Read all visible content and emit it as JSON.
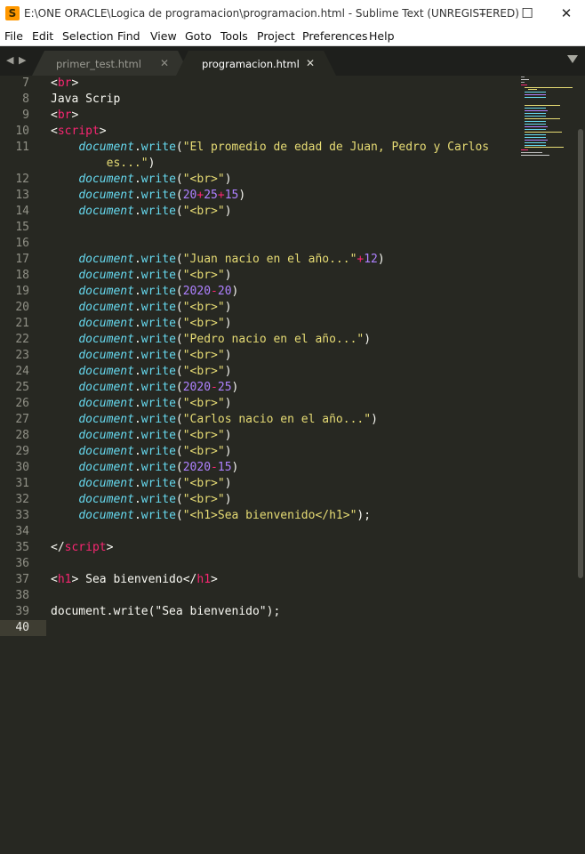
{
  "window": {
    "title": "E:\\ONE ORACLE\\Logica de programacion\\programacion.html - Sublime Text (UNREGISTERED)",
    "app_icon": "S",
    "buttons": {
      "minimize": "–",
      "maximize": "☐",
      "close": "✕"
    }
  },
  "menu": [
    "File",
    "Edit",
    "Selection",
    "Find",
    "View",
    "Goto",
    "Tools",
    "Project",
    "Preferences",
    "Help"
  ],
  "tabs": {
    "nav_left": "◀",
    "nav_right": "▶",
    "items": [
      {
        "label": "primer_test.html",
        "close": "✕",
        "active": false
      },
      {
        "label": "programacion.html",
        "close": "✕",
        "active": true
      }
    ]
  },
  "editor": {
    "active_line": "40",
    "colors": {
      "background": "#272822",
      "tag": "#f92672",
      "object": "#66d9ef",
      "string": "#e6db74",
      "number": "#ae81ff",
      "plain": "#f8f8f2"
    },
    "lines": [
      {
        "n": "7",
        "t": [
          [
            "p",
            "<"
          ],
          [
            "tag",
            "br"
          ],
          [
            "p",
            ">"
          ]
        ]
      },
      {
        "n": "8",
        "t": [
          [
            "p",
            "Java Scrip"
          ]
        ]
      },
      {
        "n": "9",
        "t": [
          [
            "p",
            "<"
          ],
          [
            "tag",
            "br"
          ],
          [
            "p",
            ">"
          ]
        ]
      },
      {
        "n": "10",
        "t": [
          [
            "p",
            "<"
          ],
          [
            "tag",
            "script"
          ],
          [
            "p",
            ">"
          ]
        ]
      },
      {
        "n": "11",
        "t": [
          [
            "p",
            "    "
          ],
          [
            "obj",
            "document"
          ],
          [
            "p",
            "."
          ],
          [
            "fn",
            "write"
          ],
          [
            "p",
            "("
          ],
          [
            "str",
            "\"El promedio de edad de Juan, Pedro y Carlos"
          ]
        ]
      },
      {
        "n": "",
        "t": [
          [
            "str",
            "        es...\""
          ],
          [
            "p",
            ")"
          ]
        ]
      },
      {
        "n": "12",
        "t": [
          [
            "p",
            "    "
          ],
          [
            "obj",
            "document"
          ],
          [
            "p",
            "."
          ],
          [
            "fn",
            "write"
          ],
          [
            "p",
            "("
          ],
          [
            "str",
            "\"<br>\""
          ],
          [
            "p",
            ")"
          ]
        ]
      },
      {
        "n": "13",
        "t": [
          [
            "p",
            "    "
          ],
          [
            "obj",
            "document"
          ],
          [
            "p",
            "."
          ],
          [
            "fn",
            "write"
          ],
          [
            "p",
            "("
          ],
          [
            "num",
            "20"
          ],
          [
            "op",
            "+"
          ],
          [
            "num",
            "25"
          ],
          [
            "op",
            "+"
          ],
          [
            "num",
            "15"
          ],
          [
            "p",
            ")"
          ]
        ]
      },
      {
        "n": "14",
        "t": [
          [
            "p",
            "    "
          ],
          [
            "obj",
            "document"
          ],
          [
            "p",
            "."
          ],
          [
            "fn",
            "write"
          ],
          [
            "p",
            "("
          ],
          [
            "str",
            "\"<br>\""
          ],
          [
            "p",
            ")"
          ]
        ]
      },
      {
        "n": "15",
        "t": []
      },
      {
        "n": "16",
        "t": []
      },
      {
        "n": "17",
        "t": [
          [
            "p",
            "    "
          ],
          [
            "obj",
            "document"
          ],
          [
            "p",
            "."
          ],
          [
            "fn",
            "write"
          ],
          [
            "p",
            "("
          ],
          [
            "str",
            "\"Juan nacio en el año...\""
          ],
          [
            "op",
            "+"
          ],
          [
            "num",
            "12"
          ],
          [
            "p",
            ")"
          ]
        ]
      },
      {
        "n": "18",
        "t": [
          [
            "p",
            "    "
          ],
          [
            "obj",
            "document"
          ],
          [
            "p",
            "."
          ],
          [
            "fn",
            "write"
          ],
          [
            "p",
            "("
          ],
          [
            "str",
            "\"<br>\""
          ],
          [
            "p",
            ")"
          ]
        ]
      },
      {
        "n": "19",
        "t": [
          [
            "p",
            "    "
          ],
          [
            "obj",
            "document"
          ],
          [
            "p",
            "."
          ],
          [
            "fn",
            "write"
          ],
          [
            "p",
            "("
          ],
          [
            "num",
            "2020"
          ],
          [
            "op",
            "-"
          ],
          [
            "num",
            "20"
          ],
          [
            "p",
            ")"
          ]
        ]
      },
      {
        "n": "20",
        "t": [
          [
            "p",
            "    "
          ],
          [
            "obj",
            "document"
          ],
          [
            "p",
            "."
          ],
          [
            "fn",
            "write"
          ],
          [
            "p",
            "("
          ],
          [
            "str",
            "\"<br>\""
          ],
          [
            "p",
            ")"
          ]
        ]
      },
      {
        "n": "21",
        "t": [
          [
            "p",
            "    "
          ],
          [
            "obj",
            "document"
          ],
          [
            "p",
            "."
          ],
          [
            "fn",
            "write"
          ],
          [
            "p",
            "("
          ],
          [
            "str",
            "\"<br>\""
          ],
          [
            "p",
            ")"
          ]
        ]
      },
      {
        "n": "22",
        "t": [
          [
            "p",
            "    "
          ],
          [
            "obj",
            "document"
          ],
          [
            "p",
            "."
          ],
          [
            "fn",
            "write"
          ],
          [
            "p",
            "("
          ],
          [
            "str",
            "\"Pedro nacio en el año...\""
          ],
          [
            "p",
            ")"
          ]
        ]
      },
      {
        "n": "23",
        "t": [
          [
            "p",
            "    "
          ],
          [
            "obj",
            "document"
          ],
          [
            "p",
            "."
          ],
          [
            "fn",
            "write"
          ],
          [
            "p",
            "("
          ],
          [
            "str",
            "\"<br>\""
          ],
          [
            "p",
            ")"
          ]
        ]
      },
      {
        "n": "24",
        "t": [
          [
            "p",
            "    "
          ],
          [
            "obj",
            "document"
          ],
          [
            "p",
            "."
          ],
          [
            "fn",
            "write"
          ],
          [
            "p",
            "("
          ],
          [
            "str",
            "\"<br>\""
          ],
          [
            "p",
            ")"
          ]
        ]
      },
      {
        "n": "25",
        "t": [
          [
            "p",
            "    "
          ],
          [
            "obj",
            "document"
          ],
          [
            "p",
            "."
          ],
          [
            "fn",
            "write"
          ],
          [
            "p",
            "("
          ],
          [
            "num",
            "2020"
          ],
          [
            "op",
            "-"
          ],
          [
            "num",
            "25"
          ],
          [
            "p",
            ")"
          ]
        ]
      },
      {
        "n": "26",
        "t": [
          [
            "p",
            "    "
          ],
          [
            "obj",
            "document"
          ],
          [
            "p",
            "."
          ],
          [
            "fn",
            "write"
          ],
          [
            "p",
            "("
          ],
          [
            "str",
            "\"<br>\""
          ],
          [
            "p",
            ")"
          ]
        ]
      },
      {
        "n": "27",
        "t": [
          [
            "p",
            "    "
          ],
          [
            "obj",
            "document"
          ],
          [
            "p",
            "."
          ],
          [
            "fn",
            "write"
          ],
          [
            "p",
            "("
          ],
          [
            "str",
            "\"Carlos nacio en el año...\""
          ],
          [
            "p",
            ")"
          ]
        ]
      },
      {
        "n": "28",
        "t": [
          [
            "p",
            "    "
          ],
          [
            "obj",
            "document"
          ],
          [
            "p",
            "."
          ],
          [
            "fn",
            "write"
          ],
          [
            "p",
            "("
          ],
          [
            "str",
            "\"<br>\""
          ],
          [
            "p",
            ")"
          ]
        ]
      },
      {
        "n": "29",
        "t": [
          [
            "p",
            "    "
          ],
          [
            "obj",
            "document"
          ],
          [
            "p",
            "."
          ],
          [
            "fn",
            "write"
          ],
          [
            "p",
            "("
          ],
          [
            "str",
            "\"<br>\""
          ],
          [
            "p",
            ")"
          ]
        ]
      },
      {
        "n": "30",
        "t": [
          [
            "p",
            "    "
          ],
          [
            "obj",
            "document"
          ],
          [
            "p",
            "."
          ],
          [
            "fn",
            "write"
          ],
          [
            "p",
            "("
          ],
          [
            "num",
            "2020"
          ],
          [
            "op",
            "-"
          ],
          [
            "num",
            "15"
          ],
          [
            "p",
            ")"
          ]
        ]
      },
      {
        "n": "31",
        "t": [
          [
            "p",
            "    "
          ],
          [
            "obj",
            "document"
          ],
          [
            "p",
            "."
          ],
          [
            "fn",
            "write"
          ],
          [
            "p",
            "("
          ],
          [
            "str",
            "\"<br>\""
          ],
          [
            "p",
            ")"
          ]
        ]
      },
      {
        "n": "32",
        "t": [
          [
            "p",
            "    "
          ],
          [
            "obj",
            "document"
          ],
          [
            "p",
            "."
          ],
          [
            "fn",
            "write"
          ],
          [
            "p",
            "("
          ],
          [
            "str",
            "\"<br>\""
          ],
          [
            "p",
            ")"
          ]
        ]
      },
      {
        "n": "33",
        "t": [
          [
            "p",
            "    "
          ],
          [
            "obj",
            "document"
          ],
          [
            "p",
            "."
          ],
          [
            "fn",
            "write"
          ],
          [
            "p",
            "("
          ],
          [
            "str",
            "\"<h1>Sea bienvenido</h1>\""
          ],
          [
            "p",
            ");"
          ]
        ]
      },
      {
        "n": "34",
        "t": []
      },
      {
        "n": "35",
        "t": [
          [
            "p",
            "</"
          ],
          [
            "tag",
            "script"
          ],
          [
            "p",
            ">"
          ]
        ]
      },
      {
        "n": "36",
        "t": []
      },
      {
        "n": "37",
        "t": [
          [
            "p",
            "<"
          ],
          [
            "tag",
            "h1"
          ],
          [
            "p",
            "> Sea bienvenido</"
          ],
          [
            "tag",
            "h1"
          ],
          [
            "p",
            ">"
          ]
        ]
      },
      {
        "n": "38",
        "t": []
      },
      {
        "n": "39",
        "t": [
          [
            "p",
            "document.write(\"Sea bienvenido\");"
          ]
        ]
      },
      {
        "n": "40",
        "t": []
      }
    ]
  }
}
